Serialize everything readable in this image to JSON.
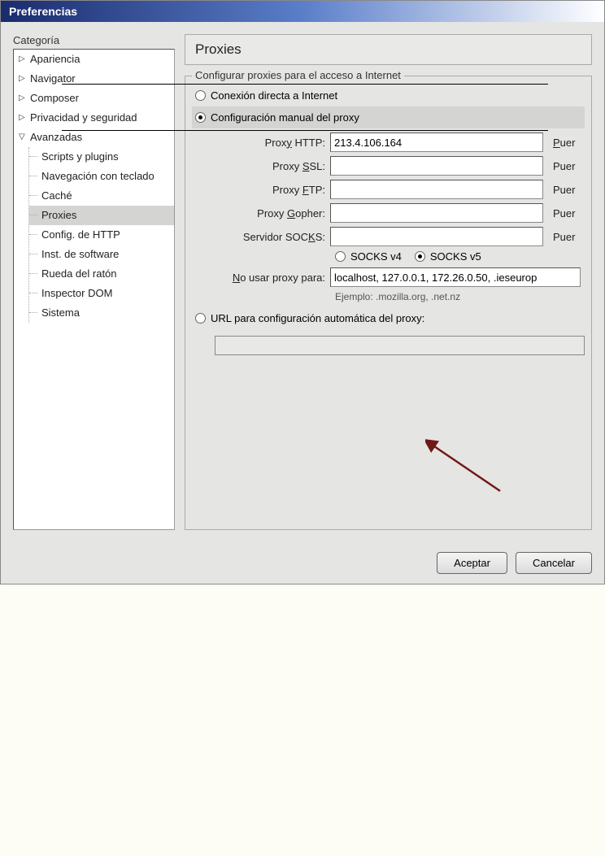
{
  "window": {
    "title": "Preferencias"
  },
  "sidebar": {
    "label": "Categoría",
    "items": {
      "apariencia": "Apariencia",
      "navigator": "Navigator",
      "composer": "Composer",
      "privacidad": "Privacidad y seguridad",
      "avanzadas": "Avanzadas",
      "scripts": "Scripts y plugins",
      "navegacion": "Navegación con teclado",
      "cache": "Caché",
      "proxies": "Proxies",
      "http": "Config. de HTTP",
      "inst": "Inst. de software",
      "rueda": "Rueda del ratón",
      "inspector": "Inspector DOM",
      "sistema": "Sistema"
    }
  },
  "page": {
    "title": "Proxies",
    "groupbox_title": "Configurar proxies para el acceso a Internet",
    "radio_direct": "Conexión directa a Internet",
    "radio_manual": "Configuración manual del proxy",
    "radio_auto": "URL para configuración automática del proxy:",
    "labels": {
      "http": "Proxy HTTP:",
      "ssl": "Proxy SSL:",
      "ftp": "Proxy FTP:",
      "gopher": "Proxy Gopher:",
      "socks": "Servidor SOCKS:",
      "noproxy": "No usar proxy para:",
      "port": "Puer"
    },
    "values": {
      "http": "213.4.106.164",
      "ssl": "",
      "ftp": "",
      "gopher": "",
      "socks": "",
      "noproxy": "localhost, 127.0.0.1, 172.26.0.50, .ieseurop"
    },
    "socks_v4": "SOCKS v4",
    "socks_v5": "SOCKS v5",
    "hint": "Ejemplo: .mozilla.org, .net.nz"
  },
  "buttons": {
    "accept": "Aceptar",
    "cancel": "Cancelar"
  }
}
